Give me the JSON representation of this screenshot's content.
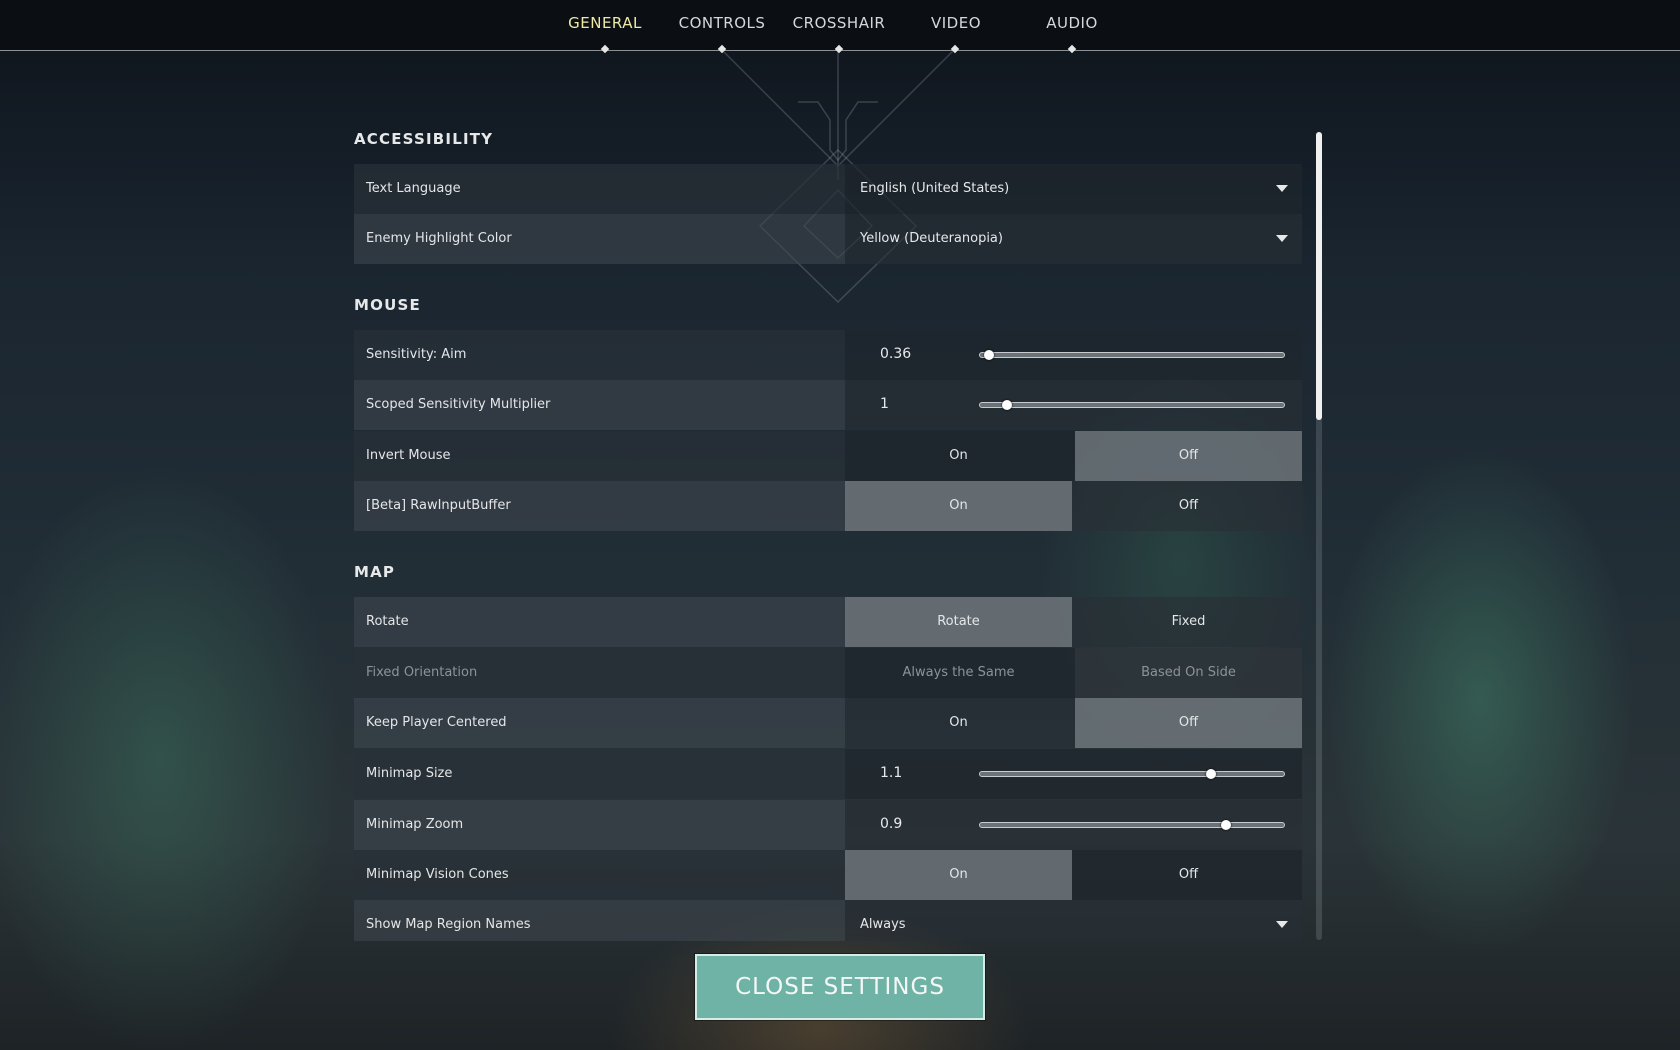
{
  "tabs": [
    {
      "label": "GENERAL",
      "active": true
    },
    {
      "label": "CONTROLS",
      "active": false
    },
    {
      "label": "CROSSHAIR",
      "active": false
    },
    {
      "label": "VIDEO",
      "active": false
    },
    {
      "label": "AUDIO",
      "active": false
    }
  ],
  "sections": {
    "accessibility": {
      "title": "ACCESSIBILITY",
      "text_language": {
        "label": "Text Language",
        "value": "English (United States)"
      },
      "enemy_highlight": {
        "label": "Enemy Highlight Color",
        "value": "Yellow (Deuteranopia)"
      }
    },
    "mouse": {
      "title": "MOUSE",
      "sens_aim": {
        "label": "Sensitivity: Aim",
        "value": "0.36",
        "fraction": 0.03
      },
      "scoped_mult": {
        "label": "Scoped Sensitivity Multiplier",
        "value": "1",
        "fraction": 0.09
      },
      "invert_mouse": {
        "label": "Invert Mouse",
        "on": "On",
        "off": "Off",
        "selected": "Off"
      },
      "raw_input": {
        "label": "[Beta] RawInputBuffer",
        "on": "On",
        "off": "Off",
        "selected": "On"
      }
    },
    "map": {
      "title": "MAP",
      "rotate": {
        "label": "Rotate",
        "opt1": "Rotate",
        "opt2": "Fixed",
        "selected": "Rotate"
      },
      "fixed_orientation": {
        "label": "Fixed Orientation",
        "opt1": "Always the Same",
        "opt2": "Based On Side",
        "disabled": true
      },
      "keep_centered": {
        "label": "Keep Player Centered",
        "on": "On",
        "off": "Off",
        "selected": "Off"
      },
      "minimap_size": {
        "label": "Minimap Size",
        "value": "1.1",
        "fraction": 0.76
      },
      "minimap_zoom": {
        "label": "Minimap Zoom",
        "value": "0.9",
        "fraction": 0.81
      },
      "vision_cones": {
        "label": "Minimap Vision Cones",
        "on": "On",
        "off": "Off",
        "selected": "On"
      },
      "region_names": {
        "label": "Show Map Region Names",
        "value": "Always"
      }
    }
  },
  "scroll_fraction": 0.36,
  "close_button": "CLOSE SETTINGS",
  "colors": {
    "active_tab": "#efe9a8",
    "close_button": "#6fb3a6",
    "selected_option": "#787f86"
  }
}
